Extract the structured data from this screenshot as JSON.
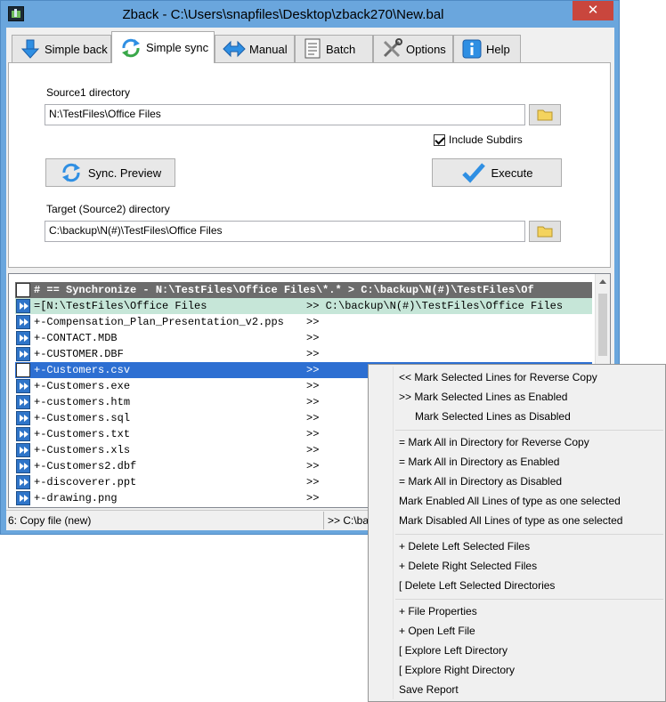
{
  "window": {
    "title": "Zback - C:\\Users\\snapfiles\\Desktop\\zback270\\New.bal",
    "close_glyph": "✕"
  },
  "tabs": [
    {
      "label": "Simple back",
      "icon": "download-arrow-icon"
    },
    {
      "label": "Simple sync",
      "icon": "sync-icon",
      "active": true
    },
    {
      "label": "Manual",
      "icon": "left-right-arrow-icon"
    },
    {
      "label": "Batch",
      "icon": "document-list-icon"
    },
    {
      "label": "Options",
      "icon": "tools-icon"
    },
    {
      "label": "Help",
      "icon": "info-icon"
    }
  ],
  "form": {
    "source_label": "Source1 directory",
    "source_value": "N:\\TestFiles\\Office Files",
    "include_subdirs_label": "Include Subdirs",
    "include_subdirs_checked": true,
    "sync_preview_label": "Sync. Preview",
    "execute_label": "Execute",
    "target_label": "Target (Source2) directory",
    "target_value": "C:\\backup\\N(#)\\TestFiles\\Office Files"
  },
  "list": {
    "header": "# == Synchronize - N:\\TestFiles\\Office Files\\*.* > C:\\backup\\N(#)\\TestFiles\\Of",
    "rows": [
      {
        "name": "=[N:\\TestFiles\\Office Files",
        "arrow": ">> C:\\backup\\N(#)\\TestFiles\\Office Files",
        "style": "green"
      },
      {
        "name": "+-Compensation_Plan_Presentation_v2.pps",
        "arrow": ">>",
        "style": ""
      },
      {
        "name": "+-CONTACT.MDB",
        "arrow": ">>",
        "style": ""
      },
      {
        "name": "+-CUSTOMER.DBF",
        "arrow": ">>",
        "style": ""
      },
      {
        "name": "+-Customers.csv",
        "arrow": ">>",
        "style": "sel"
      },
      {
        "name": "+-Customers.exe",
        "arrow": ">>",
        "style": ""
      },
      {
        "name": "+-customers.htm",
        "arrow": ">>",
        "style": ""
      },
      {
        "name": "+-Customers.sql",
        "arrow": ">>",
        "style": ""
      },
      {
        "name": "+-Customers.txt",
        "arrow": ">>",
        "style": ""
      },
      {
        "name": "+-Customers.xls",
        "arrow": ">>",
        "style": ""
      },
      {
        "name": "+-Customers2.dbf",
        "arrow": ">>",
        "style": ""
      },
      {
        "name": "+-discoverer.ppt",
        "arrow": ">>",
        "style": ""
      },
      {
        "name": "+-drawing.png",
        "arrow": ">>",
        "style": ""
      }
    ]
  },
  "status": {
    "left": "6: Copy file (new)",
    "right": ">> C:\\ba"
  },
  "context_menu": {
    "items": [
      "<< Mark Selected Lines for Reverse Copy",
      ">> Mark Selected Lines as Enabled",
      "Mark Selected Lines as Disabled",
      "= Mark All in Directory for Reverse Copy",
      "= Mark All in Directory as Enabled",
      "= Mark All in Directory as Disabled",
      "Mark Enabled All Lines of type as one selected",
      "Mark Disabled All Lines of type as one selected",
      "+ Delete Left Selected Files",
      "+ Delete Right Selected Files",
      "[  Delete Left Selected Directories",
      "+ File Properties",
      "+ Open Left File",
      "[  Explore Left  Directory",
      "[  Explore Right Directory",
      "Save Report"
    ]
  },
  "colors": {
    "title_bar": "#6aa6dd",
    "close_button": "#c9463d",
    "selected_row": "#2d6fd2",
    "root_row": "#c6e6d8",
    "header_row": "#6c6c6c"
  }
}
